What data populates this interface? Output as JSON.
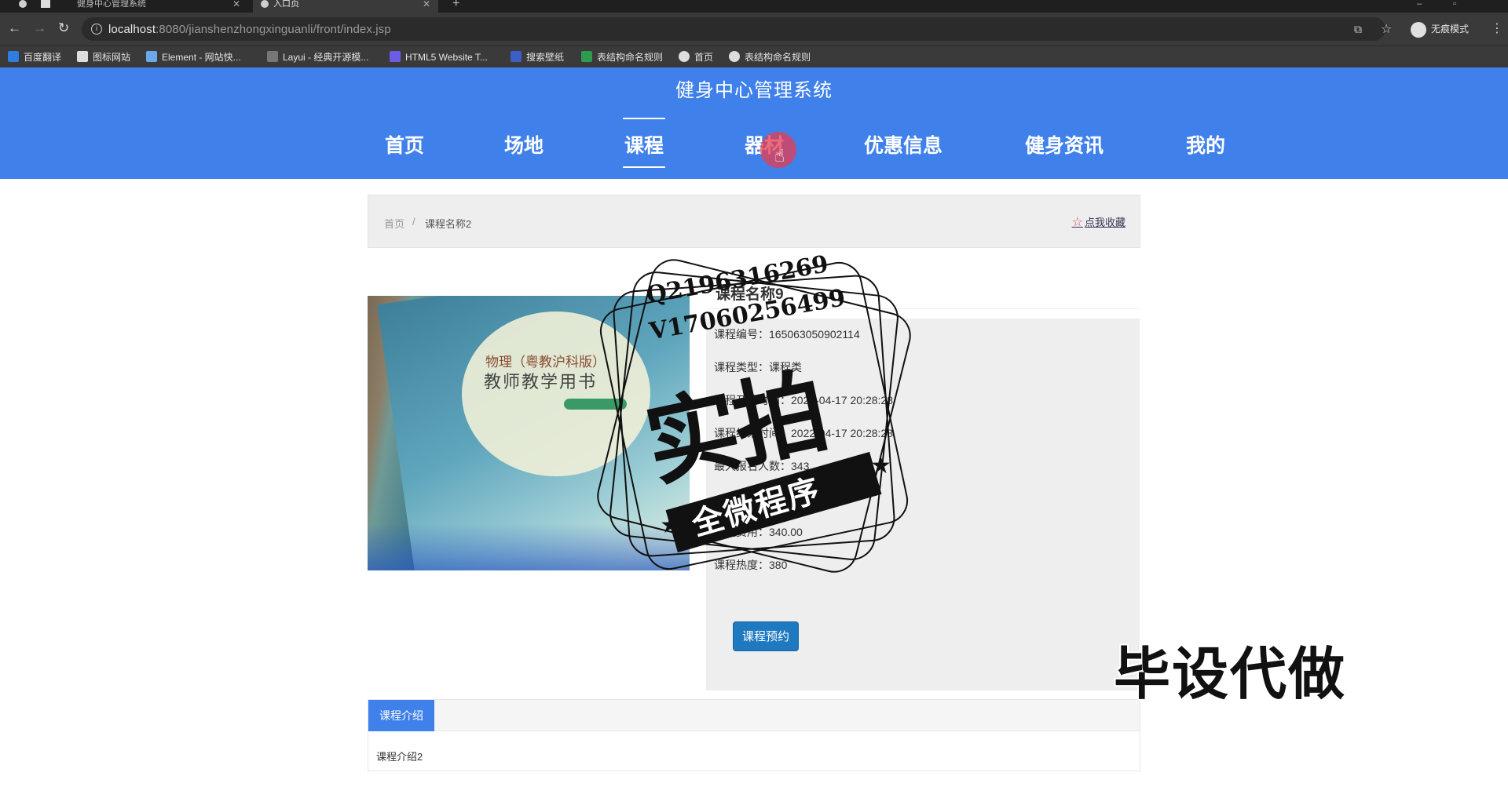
{
  "browser": {
    "tabs": [
      {
        "title": "健身中心管理系统"
      },
      {
        "title": "入口页"
      }
    ],
    "url_host": "localhost",
    "url_path": ":8080/jianshenzhongxinguanli/front/index.jsp",
    "incognito_label": "无痕模式",
    "bookmarks": [
      "百度翻译",
      "图标网站",
      "Element - 网站快...",
      "Layui - 经典开源模...",
      "HTML5 Website T...",
      "搜索壁纸",
      "表结构命名规则",
      "首页",
      "表结构命名规则"
    ]
  },
  "site": {
    "title": "健身中心管理系统",
    "nav": [
      "首页",
      "场地",
      "课程",
      "器材",
      "优惠信息",
      "健身资讯",
      "我的"
    ],
    "active_nav": "课程",
    "accent_color": "#3f80ea"
  },
  "breadcrumb": {
    "home": "首页",
    "separator": "/",
    "current": "课程名称2",
    "favorite_label": "点我收藏"
  },
  "course": {
    "name": "课程名称9",
    "fields": [
      "课程编号：165063050902114",
      "课程类型：课程类",
      "课程开始时间：2022-04-17 20:28:28",
      "课程结束时间：2022-04-17 20:28:28",
      "最大报名人数：343",
      "课程费用：340.00",
      "课程热度：380"
    ],
    "book_button": "课程预约"
  },
  "photo": {
    "line1": "物理（粤教沪科版）",
    "line2": "教师教学用书"
  },
  "intro": {
    "tab_label": "课程介绍",
    "text": "课程介绍2"
  },
  "watermark": {
    "q": "Q2196316269",
    "v": "V17060256499",
    "big": "实拍",
    "band": "全微程序",
    "bottom": "毕设代做"
  }
}
